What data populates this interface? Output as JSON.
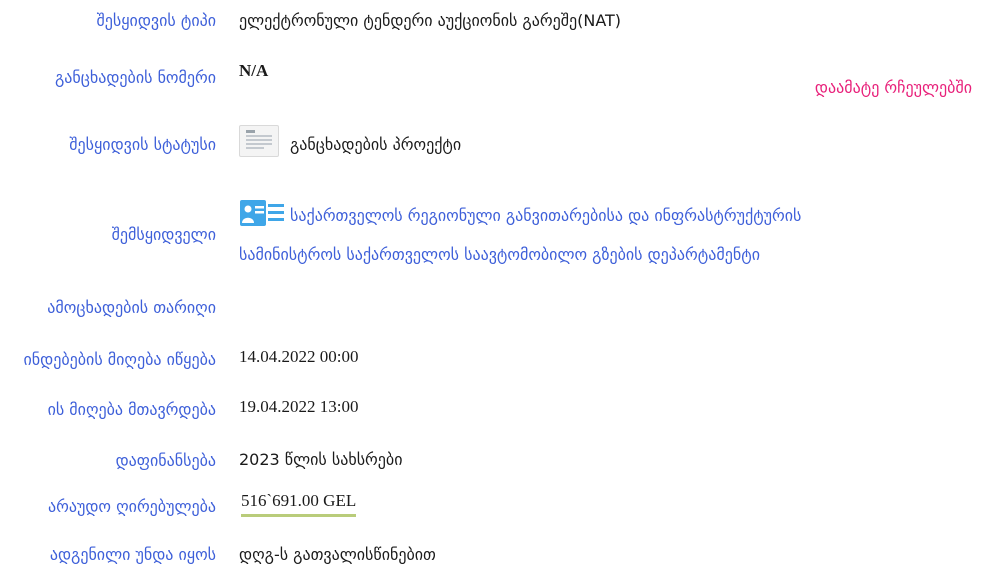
{
  "fields": {
    "procurement_type": {
      "label": "შესყიდვის ტიპი",
      "value": "ელექტრონული ტენდერი აუქციონის გარეშე(NAT)"
    },
    "application_number": {
      "label": "განცხადების ნომერი",
      "value": "N/A"
    },
    "add_favorites": "დაამატე რჩეულებში",
    "procurement_status": {
      "label": "შესყიდვის სტატუსი",
      "value": "განცხადების პროექტი",
      "icon": "document-icon"
    },
    "buyer": {
      "label": "შემსყიდველი",
      "line1": "საქართველოს რეგიონული განვითარებისა და ინფრასტრუქტურის",
      "line2": "სამინისტროს საქართველოს საავტომობილო გზების დეპარტამენტი",
      "icon": "organization-card-icon"
    },
    "announcement_date": {
      "label": "ამოცხადების თარიღი",
      "value": ""
    },
    "bids_start": {
      "label": "ინდებების მიღება იწყება",
      "value": "14.04.2022 00:00"
    },
    "bids_end": {
      "label": "ის მიღება მთავრდება",
      "value": "19.04.2022 13:00"
    },
    "financing": {
      "label": "დაფინანსება",
      "value": "2023 წლის სახსრები"
    },
    "estimated_value": {
      "label": "არაუდო ღირებულება",
      "value": "516`691.00 GEL"
    },
    "presentation": {
      "label": "ადგენილი უნდა იყოს",
      "value": "დღგ-ს გათვალისწინებით"
    }
  },
  "colors": {
    "label": "#3d5fd9",
    "link_pink": "#e8207a",
    "underline": "#b9cc7a"
  }
}
